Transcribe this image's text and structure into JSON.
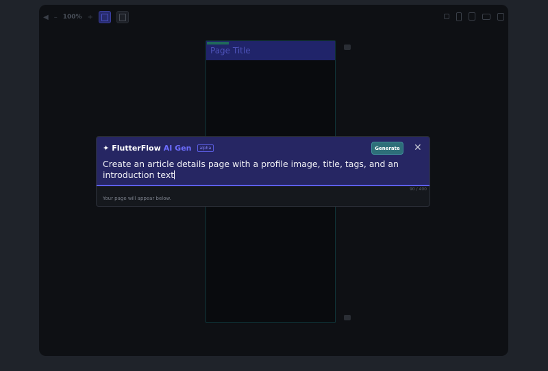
{
  "toolbar": {
    "back_icon": "arrow-left-icon",
    "zoom_minus": "–",
    "zoom_label": "100%",
    "zoom_plus": "+"
  },
  "device_preview": {
    "app_bar_title": "Page Title"
  },
  "ai_gen": {
    "brand_name": "FlutterFlow",
    "brand_accent": "AI Gen",
    "badge": "alpha",
    "generate_label": "Generate",
    "close_label": "✕",
    "prompt_text": "Create an article details page with a profile image, title, tags, and an introduction text",
    "char_count": "90 / 400",
    "hint": "Your page will appear below."
  },
  "colors": {
    "page_bg": "#1f232a",
    "editor_bg": "#0e1014",
    "accent": "#5d5ff3",
    "generate_bg": "#2e6f79",
    "app_bar": "#20246a"
  }
}
